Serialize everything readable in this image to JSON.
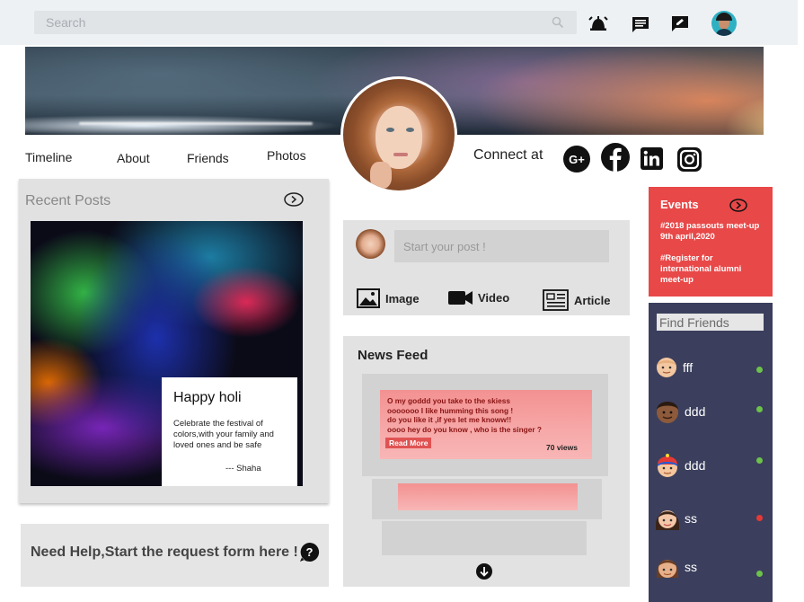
{
  "header": {
    "search_placeholder": "Search"
  },
  "nav": {
    "timeline": "Timeline",
    "about": "About",
    "friends": "Friends",
    "photos": "Photos",
    "connect_label": "Connect at"
  },
  "social": [
    "google-plus-icon",
    "facebook-icon",
    "linkedin-icon",
    "instagram-icon"
  ],
  "recent_posts": {
    "title": "Recent Posts",
    "card_title": "Happy holi",
    "card_text": "Celebrate the festival of colors,with your family and loved ones and be safe",
    "card_author": "--- Shaha"
  },
  "help": {
    "text": "Need Help,Start the request form here !"
  },
  "compose": {
    "placeholder": "Start your post !",
    "image_label": "Image",
    "video_label": "Video",
    "article_label": "Article"
  },
  "news_feed": {
    "title": "News Feed",
    "post_lines": [
      "O my goddd you take to the skiess",
      "ooooooo I like humming this song !",
      "do you like it ,if yes let me knoww!!",
      "oooo hey do you know , who is the singer ?"
    ],
    "read_more": "Read More",
    "views": "70 views"
  },
  "events": {
    "title": "Events",
    "items": [
      "#2018 passouts meet-up\n   9th april,2020",
      "#Register for international alumni meet-up"
    ]
  },
  "friends": {
    "placeholder": "Find Friends",
    "list": [
      {
        "name": "fff",
        "status_color": "#6cc24a"
      },
      {
        "name": "ddd",
        "status_color": "#6cc24a"
      },
      {
        "name": "ddd",
        "status_color": "#6cc24a"
      },
      {
        "name": "ss",
        "status_color": "#e53935"
      },
      {
        "name": "ss",
        "status_color": "#6cc24a"
      }
    ]
  },
  "colors": {
    "accent_red": "#e84848",
    "sidebar_navy": "#3b3f5d",
    "panel_gray": "#e2e2e2"
  }
}
